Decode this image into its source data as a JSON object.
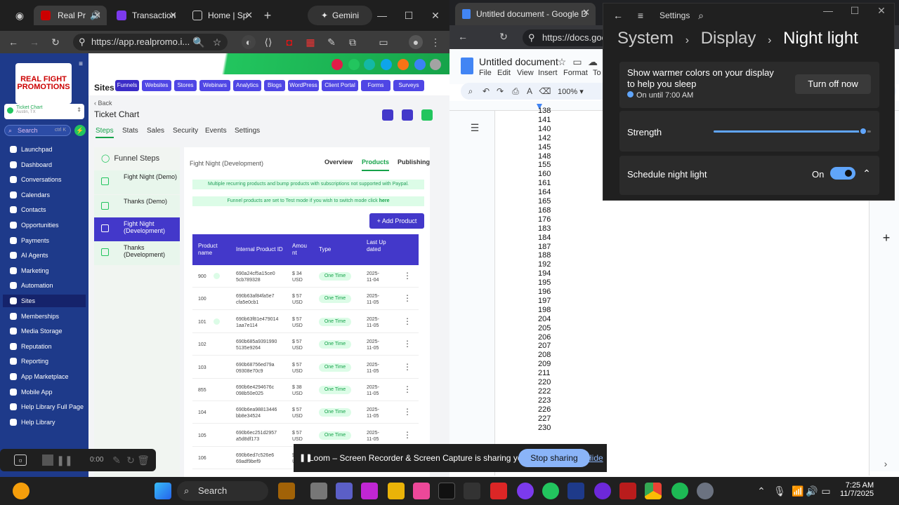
{
  "chrome_left": {
    "tabs": [
      "Real Pr",
      "Transaction",
      "Home | Sp",
      "Gemini"
    ],
    "url": "https://app.realpromo.i..."
  },
  "crm": {
    "logo": "REAL FIGHT PROMOTIONS",
    "location": {
      "name": "Ticket Chart",
      "sub": "Austin, TX"
    },
    "search": {
      "placeholder": "Search",
      "shortcut": "ctrl K"
    },
    "nav": [
      "Launchpad",
      "Dashboard",
      "Conversations",
      "Calendars",
      "Contacts",
      "Opportunities",
      "Payments",
      "AI Agents",
      "Marketing",
      "Automation",
      "Sites",
      "Memberships",
      "Media Storage",
      "Reputation",
      "Reporting",
      "App Marketplace",
      "Mobile App",
      "Help Library Full Page",
      "Help Library"
    ],
    "active_nav": "Sites",
    "sites_title": "Sites",
    "subnav": [
      "Funnels",
      "Websites",
      "Stores",
      "Webinars",
      "Analytics",
      "Blogs",
      "WordPress",
      "Client Portal",
      "Forms",
      "Surveys"
    ],
    "back": "Back",
    "page_title": "Ticket Chart",
    "tabs": [
      "Steps",
      "Stats",
      "Sales",
      "Security",
      "Events",
      "Settings"
    ],
    "funnel_steps_title": "Funnel Steps",
    "steps": [
      "Fight Night (Demo)",
      "Thanks (Demo)",
      "Fight Night (Development)",
      "Thanks (Development)"
    ],
    "step_name": "Fight Night (Development)",
    "step_tabs": [
      "Overview",
      "Products",
      "Publishing"
    ],
    "banner1": "Multiple recurring products and bump products with subscriptions not supported with Paypal.",
    "banner2": "Funnel products are set to Test mode if you wish to switch mode click",
    "banner2_link": "here",
    "add_product": "+ Add Product",
    "table_headers": [
      "Product name",
      "Internal Product ID",
      "Amount",
      "Type",
      "Last Updated"
    ],
    "rows": [
      {
        "name": "900",
        "id": "690a24cf5a15ce0 5cb789328",
        "amount": "$ 34 USD",
        "type": "One Time",
        "date": "2025- 11-04"
      },
      {
        "name": "100",
        "id": "690b63af84fa5e7 cfa5e0cb1",
        "amount": "$ 57 USD",
        "type": "One Time",
        "date": "2025- 11-05"
      },
      {
        "name": "101",
        "id": "690b63f81e479014 1aa7e114",
        "amount": "$ 57 USD",
        "type": "One Time",
        "date": "2025- 11-05"
      },
      {
        "name": "102",
        "id": "690b685a9391990 5135e9264",
        "amount": "$ 57 USD",
        "type": "One Time",
        "date": "2025- 11-05"
      },
      {
        "name": "103",
        "id": "690b68756ed79a 09308e70c9",
        "amount": "$ 57 USD",
        "type": "One Time",
        "date": "2025- 11-05"
      },
      {
        "name": "855",
        "id": "690b6e4294676c 098b50e025",
        "amount": "$ 38 USD",
        "type": "One Time",
        "date": "2025- 11-05"
      },
      {
        "name": "104",
        "id": "690b6ea98813446 bb8e34524",
        "amount": "$ 57 USD",
        "type": "One Time",
        "date": "2025- 11-05"
      },
      {
        "name": "105",
        "id": "690b6ec251d2957 a5d8df173",
        "amount": "$ 57 USD",
        "type": "One Time",
        "date": "2025- 11-05"
      },
      {
        "name": "106",
        "id": "690b6ed7c526e6 69adf9bef9",
        "amount": "$ 57 USD",
        "type": "One Time",
        "date": "2025- 11-05"
      }
    ]
  },
  "recorder": {
    "time": "0:00"
  },
  "docs": {
    "tab": "Untitled document - Google D",
    "url": "https://docs.goog",
    "title": "Untitled document",
    "menu": [
      "File",
      "Edit",
      "View",
      "Insert",
      "Format",
      "To"
    ],
    "zoom": "100%",
    "numbers": [
      "138",
      "141",
      "140",
      "142",
      "145",
      "148",
      "155",
      "160",
      "161",
      "164",
      "165",
      "168",
      "176",
      "183",
      "184",
      "187",
      "188",
      "192",
      "194",
      "195",
      "196",
      "197",
      "198",
      "204",
      "205",
      "206",
      "207",
      "208",
      "209",
      "211",
      "220",
      "222",
      "223",
      "226",
      "227",
      "230"
    ]
  },
  "settings": {
    "app_title": "Settings",
    "breadcrumb": [
      "System",
      "Display",
      "Night light"
    ],
    "warmer_text": "Show warmer colors on your display to help you sleep",
    "status": "On until 7:00 AM",
    "turn_off_button": "Turn off now",
    "strength_label": "Strength",
    "strength_value": 0.95,
    "schedule_label": "Schedule night light",
    "schedule_state": "On"
  },
  "loom": {
    "message": "Loom – Screen Recorder & Screen Capture is sharing your screen.",
    "stop": "Stop sharing",
    "hide": "Hide"
  },
  "taskbar": {
    "search": "Search",
    "time": "7:25 AM",
    "date": "11/7/2025"
  }
}
